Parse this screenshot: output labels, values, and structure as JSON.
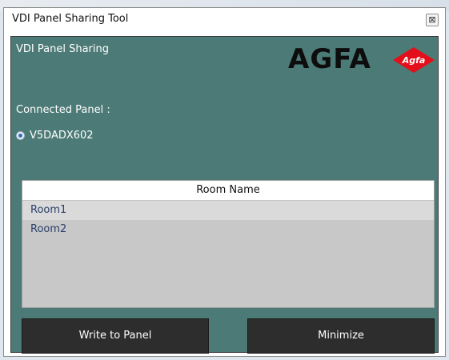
{
  "window": {
    "title": "VDI Panel Sharing Tool",
    "close_glyph": "⊠"
  },
  "app": {
    "heading": "VDI Panel Sharing",
    "logo_text": "AGFA",
    "logo_badge_text": "Agfa",
    "logo_badge_color": "#e3101b"
  },
  "connected_panel": {
    "label": "Connected Panel :",
    "selected_option": "V5DADX602"
  },
  "room_table": {
    "header": "Room Name",
    "rows": [
      "Room1",
      "Room2"
    ],
    "selected_index": 0
  },
  "buttons": {
    "write_label": "Write to Panel",
    "minimize_label": "Minimize"
  },
  "colors": {
    "panel_background": "#4c7a76",
    "button_background": "#2d2d2d"
  }
}
